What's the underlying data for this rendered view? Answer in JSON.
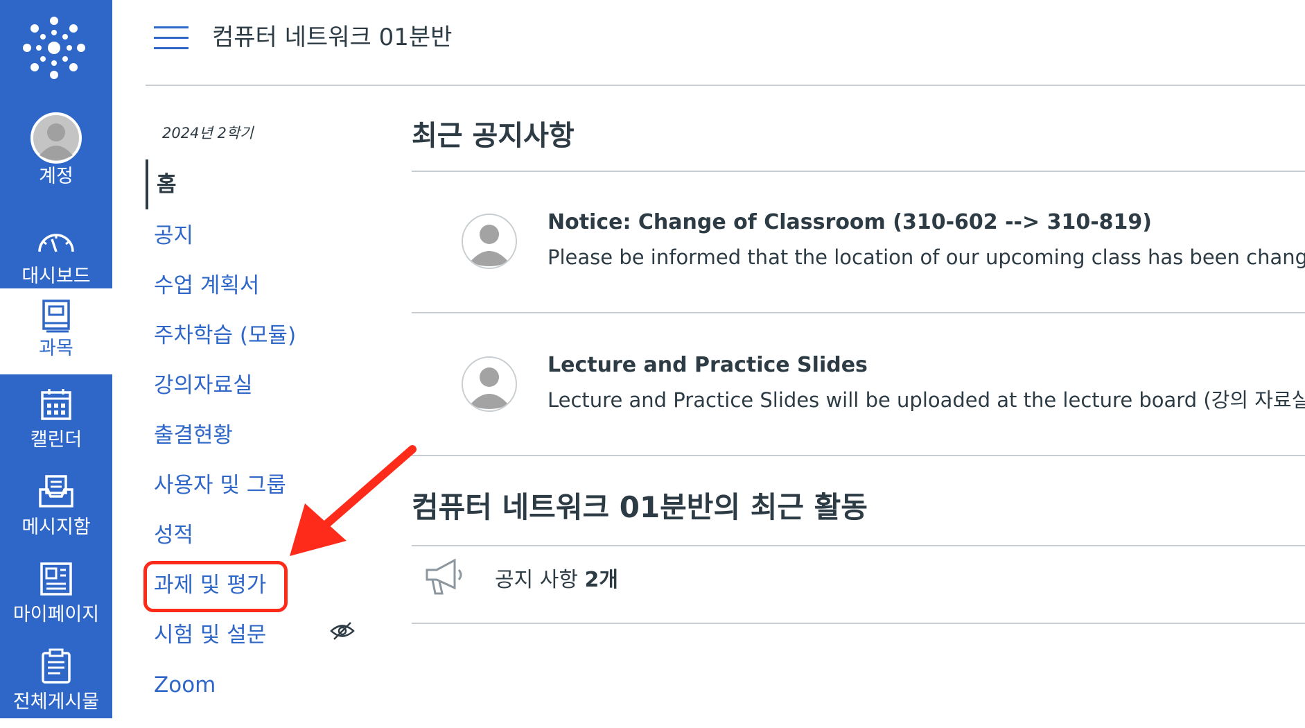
{
  "global_nav": {
    "items": [
      {
        "label": "계정",
        "icon": "avatar-icon"
      },
      {
        "label": "대시보드",
        "icon": "dashboard-gauge-icon"
      },
      {
        "label": "과목",
        "icon": "courses-book-icon",
        "active": true
      },
      {
        "label": "캘린더",
        "icon": "calendar-icon"
      },
      {
        "label": "메시지함",
        "icon": "inbox-icon"
      },
      {
        "label": "마이페이지",
        "icon": "mypage-icon"
      },
      {
        "label": "전체게시물",
        "icon": "board-icon"
      }
    ],
    "background": "#2f67c9"
  },
  "header": {
    "course_title": "컴퓨터 네트워크 01분반"
  },
  "course_nav": {
    "term": "2024년 2학기",
    "items": [
      {
        "label": "홈",
        "active": true
      },
      {
        "label": "공지"
      },
      {
        "label": "수업 계획서"
      },
      {
        "label": "주차학습 (모듈)"
      },
      {
        "label": "강의자료실"
      },
      {
        "label": "출결현황"
      },
      {
        "label": "사용자 및 그룹"
      },
      {
        "label": "성적"
      },
      {
        "label": "과제 및 평가",
        "highlighted": true
      },
      {
        "label": "시험 및 설문",
        "hidden_icon": "eye-slash-icon"
      },
      {
        "label": "Zoom"
      }
    ]
  },
  "main": {
    "recent_announcements_title": "최근 공지사항",
    "announcements": [
      {
        "title": "Notice: Change of Classroom (310-602 --> 310-819)",
        "body": "Please be informed that the location of our upcoming class has been changed."
      },
      {
        "title": "Lecture and Practice Slides",
        "body": "Lecture and Practice Slides will be uploaded at the lecture board (강의 자료실)"
      }
    ],
    "activity_title": "컴퓨터 네트워크 01분반의 최근 활동",
    "activity_prefix": "공지 사항 ",
    "activity_count": "2개"
  },
  "colors": {
    "accent": "#2f67c9",
    "highlight": "#ff2b1a",
    "text": "#2d3b45"
  }
}
